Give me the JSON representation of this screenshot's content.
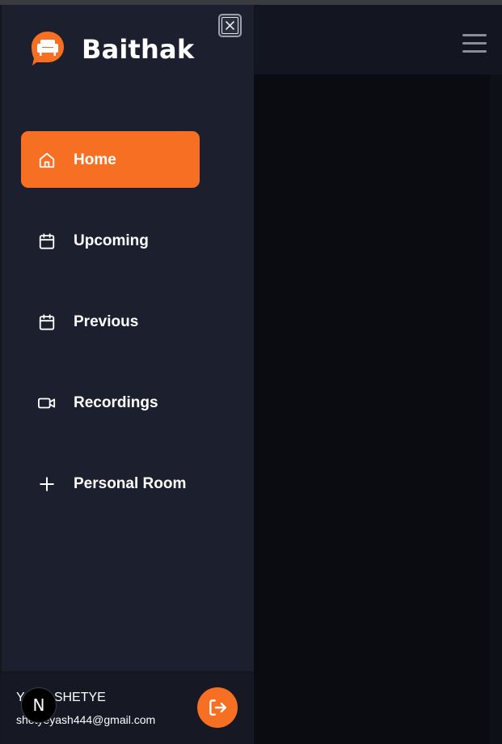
{
  "app": {
    "brand": "Baithak",
    "accent_color": "#f66f22",
    "sidebar_bg": "#1c1f2e"
  },
  "sidebar": {
    "close_icon": "close-icon",
    "items": [
      {
        "label": "Home",
        "icon": "home-icon",
        "active": true
      },
      {
        "label": "Upcoming",
        "icon": "calendar-icon",
        "active": false
      },
      {
        "label": "Previous",
        "icon": "calendar-icon",
        "active": false
      },
      {
        "label": "Recordings",
        "icon": "video-icon",
        "active": false
      },
      {
        "label": "Personal Room",
        "icon": "plus-icon",
        "active": false
      }
    ]
  },
  "user": {
    "name": "YASH SHETYE",
    "email": "shetyeyash444@gmail.com",
    "badge_letter": "N",
    "logout_icon": "logout-icon"
  },
  "header": {
    "menu_icon": "hamburger-menu-icon"
  }
}
